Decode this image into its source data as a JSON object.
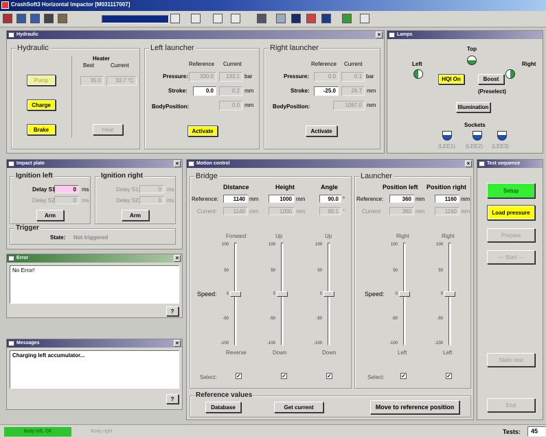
{
  "app_title": "CrashSoft3 Horizontal Impactor [M031117007]",
  "toolbar": {
    "icons": [
      "people-icon",
      "import-icon",
      "chart-icon",
      "save-icon",
      "bars-icon",
      "window-icon",
      "view1-icon",
      "view2-icon",
      "monitor-icon",
      "grid-icon",
      "moon-icon",
      "target-icon",
      "info-icon",
      "green-icon",
      "display-icon"
    ]
  },
  "hydraulic": {
    "window_title": "Hydraulic",
    "group": "Hydraulic",
    "heater_label": "Heater",
    "best_label": "Best",
    "current_label": "Current",
    "best_value": "35.0",
    "current_value": "33.7 °C",
    "pump": "Pump",
    "charge": "Charge",
    "brake": "Brake",
    "heat": "Heat",
    "left": {
      "title": "Left launcher",
      "reference": "Reference",
      "current": "Current",
      "pressure_label": "Pressure:",
      "pressure_ref": "330.0",
      "pressure_cur": "133.1",
      "pressure_unit": "bar",
      "stroke_label": "Stroke:",
      "stroke_ref": "0.0",
      "stroke_cur": "0.2",
      "stroke_unit": "mm",
      "body_label": "BodyPosition:",
      "body_cur": "0.0",
      "body_unit": "mm",
      "activate": "Activate"
    },
    "right": {
      "title": "Right launcher",
      "reference": "Reference",
      "current": "Current",
      "pressure_label": "Pressure:",
      "pressure_ref": "0.0",
      "pressure_cur": "0.1",
      "pressure_unit": "bar",
      "stroke_label": "Stroke:",
      "stroke_ref": "-25.0",
      "stroke_cur": "26.7",
      "stroke_unit": "mm",
      "body_label": "BodyPosition:",
      "body_cur": "1087.0",
      "body_unit": "mm",
      "activate": "Activate"
    }
  },
  "lamps": {
    "window_title": "Lamps",
    "top": "Top",
    "left": "Left",
    "right": "Right",
    "hqi": "HQI On",
    "boost": "Boost",
    "preselect": "(Preselect)",
    "illumination": "Illumination",
    "sockets": "Sockets",
    "s1": "(LEE1)",
    "s2": "(LEE2)",
    "s3": "(LEE3)"
  },
  "impact": {
    "window_title": "Impact plate",
    "ign_left": "Ignition left",
    "ign_right": "Ignition right",
    "delay_s1": "Delay S1:",
    "delay_s2": "Delay S2:",
    "l_s1": "0",
    "l_s2": "0",
    "r_s1": "0",
    "r_s2": "0",
    "unit": "ms",
    "arm": "Arm",
    "trigger": "Trigger",
    "state_label": "State:",
    "state_value": "Not triggered"
  },
  "error": {
    "window_title": "Error",
    "text": "No Error!",
    "help": "?"
  },
  "messages": {
    "window_title": "Messages",
    "text": "Charging left accumulator...",
    "help": "?"
  },
  "motion": {
    "window_title": "Motion control",
    "bridge": "Bridge",
    "launcher": "Launcher",
    "distance": "Distance",
    "height": "Height",
    "angle": "Angle",
    "pos_left": "Position left",
    "pos_right": "Position right",
    "reference": "Reference:",
    "current": "Current:",
    "ref_distance": "1140",
    "ref_height": "1000",
    "ref_angle": "90.0",
    "ref_pl": "360",
    "ref_pr": "1160",
    "cur_distance": "1140",
    "cur_height": "1000",
    "cur_angle": "90.1",
    "cur_pl": "360",
    "cur_pr": "1160",
    "mm": "mm",
    "deg": "°",
    "speed": "Speed:",
    "select": "Select:",
    "tick_100": "100",
    "tick_50": "50",
    "tick_0": "0",
    "tick_m50": "-50",
    "tick_m100": "-100",
    "s_forward": "Forward",
    "s_up1": "Up",
    "s_up2": "Up",
    "s_right1": "Right",
    "s_right2": "Right",
    "s_reverse": "Reverse",
    "s_down1": "Down",
    "s_down2": "Down",
    "s_left1": "Left",
    "s_left2": "Left",
    "check": "✓",
    "ref_values": "Reference values",
    "database": "Database",
    "get_current": "Get current",
    "move_ref": "Move to reference position"
  },
  "sequence": {
    "window_title": "Test sequence",
    "setup": "Setup",
    "load_pressure": "Load pressure",
    "prepare": "Prepare",
    "start": "--- Start ---",
    "static_test": "Static test",
    "end": "End"
  },
  "status": {
    "body_left": "Body left, OK",
    "body_right": "Body right",
    "tests_label": "Tests:",
    "tests_value": "45"
  }
}
